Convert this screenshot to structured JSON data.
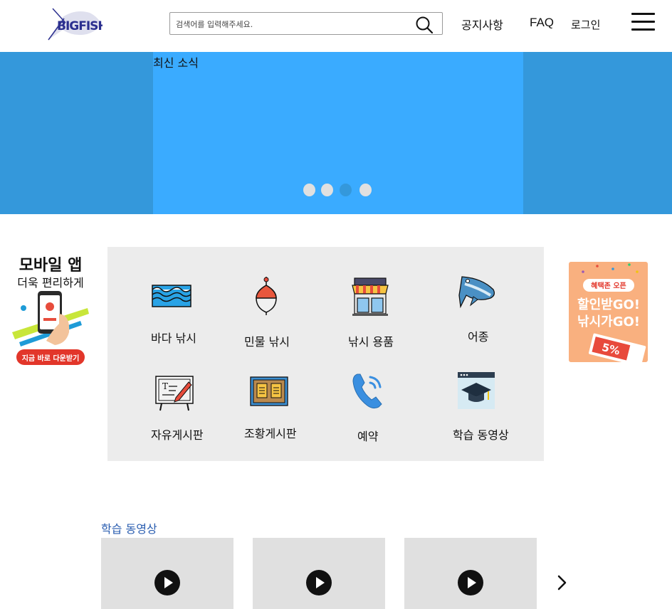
{
  "header": {
    "logo_text": "BIGFISH",
    "search": {
      "placeholder": "검색어를 입력해주세요.",
      "value": ""
    },
    "nav": {
      "notice": "공지사항",
      "faq": "FAQ",
      "login": "로그인"
    }
  },
  "hero": {
    "title": "최신 소식",
    "dots": 4,
    "active_dot": 3
  },
  "left_banner": {
    "line1": "모바일 앱",
    "line2": "더욱 편리하게",
    "button": "지금 바로 다운받기"
  },
  "right_banner": {
    "tag": "혜택존 오픈",
    "line1": "할인받GO!",
    "line2": "낚시가GO!",
    "coupon": "5%"
  },
  "categories": [
    {
      "label": "바다 낚시",
      "icon": "waves-icon"
    },
    {
      "label": "민물 낚시",
      "icon": "fishing-float-icon"
    },
    {
      "label": "낚시 용품",
      "icon": "store-icon"
    },
    {
      "label": "어종",
      "icon": "fish-icon"
    },
    {
      "label": "자유게시판",
      "icon": "board-icon"
    },
    {
      "label": "조황게시판",
      "icon": "report-board-icon"
    },
    {
      "label": "예약",
      "icon": "phone-icon"
    },
    {
      "label": "학습 동영상",
      "icon": "graduation-video-icon"
    }
  ],
  "videos": {
    "heading": "학습 동영상",
    "count": 3
  },
  "colors": {
    "hero_bg": "#3498db",
    "hero_slide": "#3aabff",
    "category_bg": "#ececec",
    "video_heading": "#2a5db0"
  }
}
